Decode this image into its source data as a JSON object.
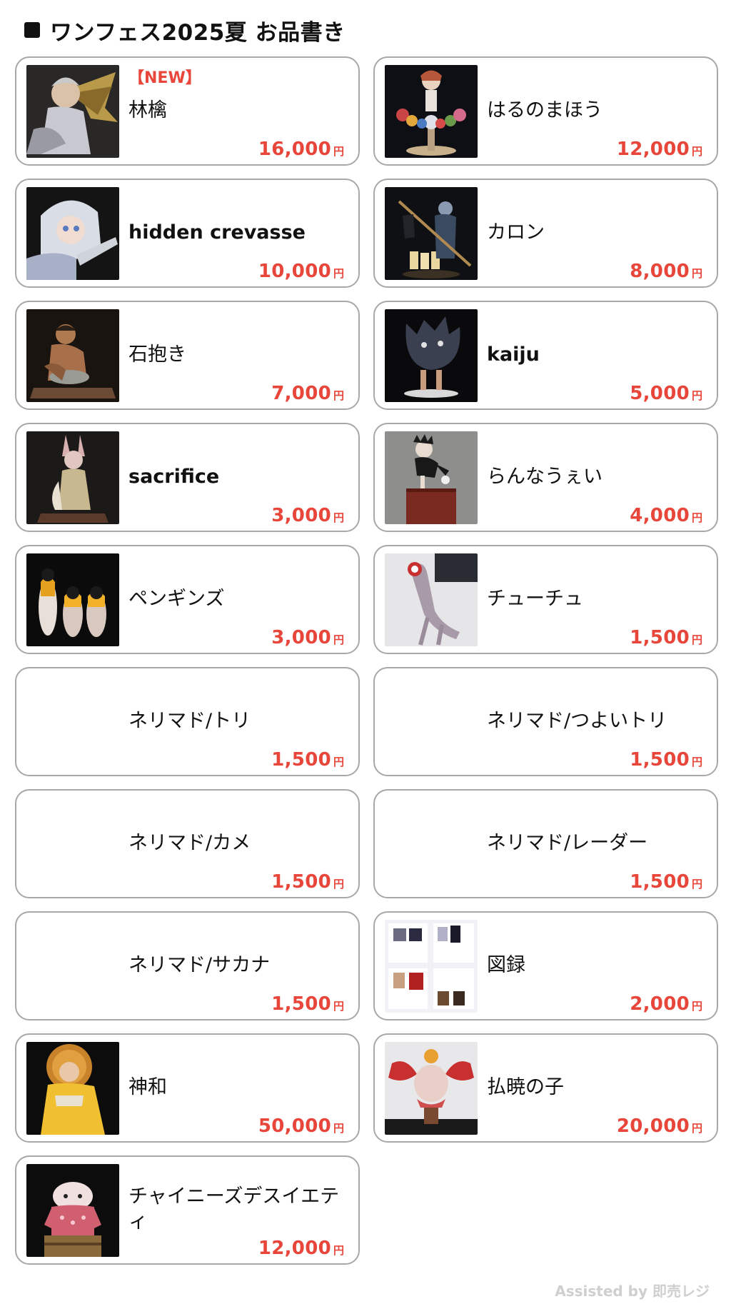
{
  "header": {
    "title": "ワンフェス2025夏 お品書き"
  },
  "currency_unit": "円",
  "colors": {
    "price": "#e8463a",
    "new_badge": "#e8463a",
    "card_border": "#a8a8a8",
    "footer": "#cfcfcf"
  },
  "items": [
    {
      "badge": "【NEW】",
      "name": "林檎",
      "price": "16,000",
      "image": "figure-photo-winged-girl"
    },
    {
      "name": "はるのまほう",
      "price": "12,000",
      "image": "figure-photo-flower-girl"
    },
    {
      "name": "hidden crevasse",
      "price": "10,000",
      "image": "figure-photo-white-hooded-girl"
    },
    {
      "name": "カロン",
      "price": "8,000",
      "image": "figure-photo-boatman"
    },
    {
      "name": "石抱き",
      "price": "7,000",
      "image": "figure-photo-kneeling-man"
    },
    {
      "name": "kaiju",
      "price": "5,000",
      "image": "figure-photo-dark-monster"
    },
    {
      "name": "sacrifice",
      "price": "3,000",
      "image": "figure-photo-rabbit-girl"
    },
    {
      "name": "らんなうぇい",
      "price": "4,000",
      "image": "figure-photo-runner-on-pedestal"
    },
    {
      "name": "ペンギンズ",
      "price": "3,000",
      "image": "figure-photo-penguins"
    },
    {
      "name": "チューチュ",
      "price": "1,500",
      "image": "figure-photo-worm-creature"
    },
    {
      "name": "ネリマド/トリ",
      "price": "1,500",
      "image": ""
    },
    {
      "name": "ネリマド/つよいトリ",
      "price": "1,500",
      "image": ""
    },
    {
      "name": "ネリマド/カメ",
      "price": "1,500",
      "image": ""
    },
    {
      "name": "ネリマド/レーダー",
      "price": "1,500",
      "image": ""
    },
    {
      "name": "ネリマド/サカナ",
      "price": "1,500",
      "image": ""
    },
    {
      "name": "図録",
      "price": "2,000",
      "image": "catalog-book-photo"
    },
    {
      "name": "神和",
      "price": "50,000",
      "image": "figure-photo-golden-headdress"
    },
    {
      "name": "払暁の子",
      "price": "20,000",
      "image": "figure-photo-red-winged-baby"
    },
    {
      "name": "チャイニーズデスイエティ",
      "price": "12,000",
      "image": "figure-photo-pink-yeti"
    }
  ],
  "footer": {
    "credit": "Assisted by 即売レジ"
  }
}
